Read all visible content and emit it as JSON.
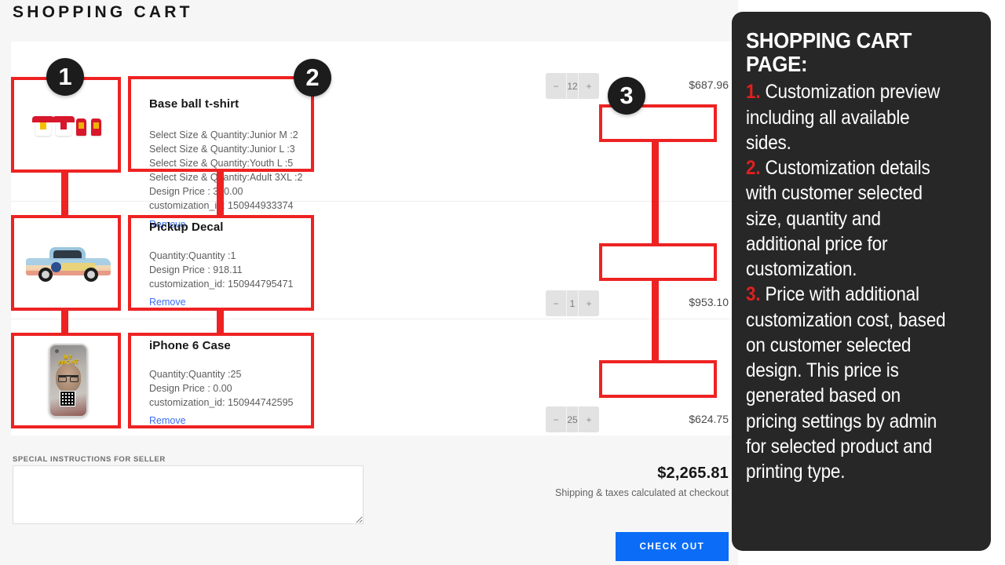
{
  "page": {
    "title": "SHOPPING CART"
  },
  "cart": {
    "items": [
      {
        "name": "Base ball t-shirt",
        "thumbnail_icon": "tshirt-previews-icon",
        "details": "Select Size & Quantity:Junior M :2\nSelect Size & Quantity:Junior L :3\nSelect Size & Quantity:Youth L :5\nSelect Size & Quantity:Adult 3XL :2\nDesign Price : 340.00\ncustomization_id: 150944933374",
        "remove_label": "Remove",
        "quantity": "12",
        "decrement_label": "−",
        "increment_label": "+",
        "line_price": "$687.96"
      },
      {
        "name": "Pickup Decal",
        "thumbnail_icon": "pickup-truck-preview-icon",
        "details": "Quantity:Quantity :1\nDesign Price : 918.11\ncustomization_id: 150944795471",
        "remove_label": "Remove",
        "quantity": "1",
        "decrement_label": "−",
        "increment_label": "+",
        "line_price": "$953.10"
      },
      {
        "name": "iPhone 6 Case",
        "thumbnail_icon": "phone-case-preview-icon",
        "details": "Quantity:Quantity :25\nDesign Price : 0.00\ncustomization_id: 150944742595",
        "remove_label": "Remove",
        "quantity": "25",
        "decrement_label": "−",
        "increment_label": "+",
        "line_price": "$624.75"
      }
    ]
  },
  "footer": {
    "special_instructions_label": "SPECIAL INSTRUCTIONS FOR SELLER",
    "special_instructions_value": "",
    "special_instructions_placeholder": "",
    "subtotal_amount": "$2,265.81",
    "shipping_note": "Shipping & taxes calculated at checkout",
    "checkout_label": "CHECK OUT"
  },
  "annotations": {
    "badges": [
      "1",
      "2",
      "3"
    ],
    "panel": {
      "heading": "SHOPPING CART PAGE:",
      "items": [
        {
          "num": "1.",
          "text": " Customization preview including all available sides."
        },
        {
          "num": "2.",
          "text": " Customization details with customer selected size, quantity and additional price for customization."
        },
        {
          "num": "3.",
          "text": " Price with additional customization cost, based on customer selected design. This price is generated based on pricing settings by admin for selected product and printing type."
        }
      ]
    }
  },
  "colors": {
    "annotation_red": "#ee2222",
    "checkout_blue": "#0a6cf7",
    "remove_link_blue": "#3b6ef5",
    "panel_dark": "#272727",
    "page_background": "#f6f6f6"
  }
}
